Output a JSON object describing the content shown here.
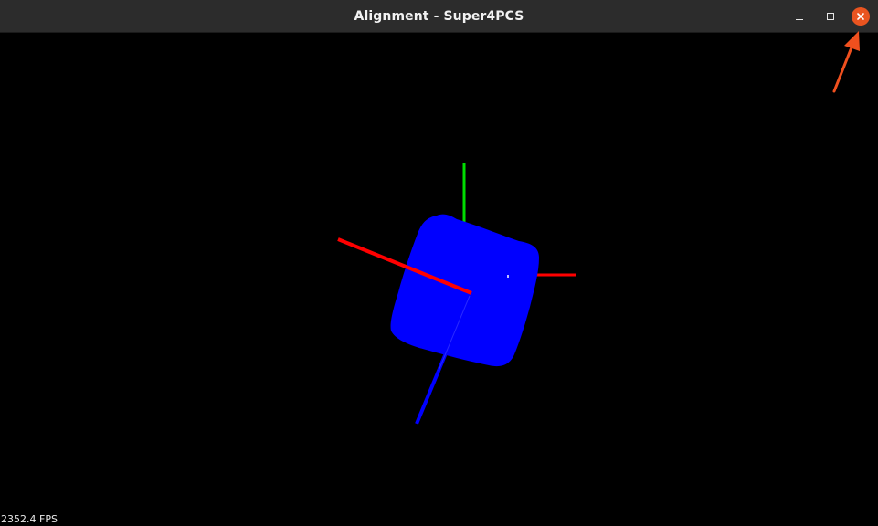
{
  "window": {
    "title": "Alignment - Super4PCS"
  },
  "titlebar_buttons": {
    "minimize_icon": "minimize-icon",
    "maximize_icon": "maximize-icon",
    "close_icon": "close-icon"
  },
  "viewport": {
    "background": "#000000",
    "fps_text": "2352.4 FPS",
    "axes": {
      "x_color": "#ff0000",
      "y_color": "#00dd00",
      "z_color": "#0000ff"
    },
    "object_color": "#0000ff"
  },
  "colors": {
    "titlebar": "#2c2c2c",
    "close_button": "#e95420",
    "annotation_arrow": "#f0501e"
  }
}
